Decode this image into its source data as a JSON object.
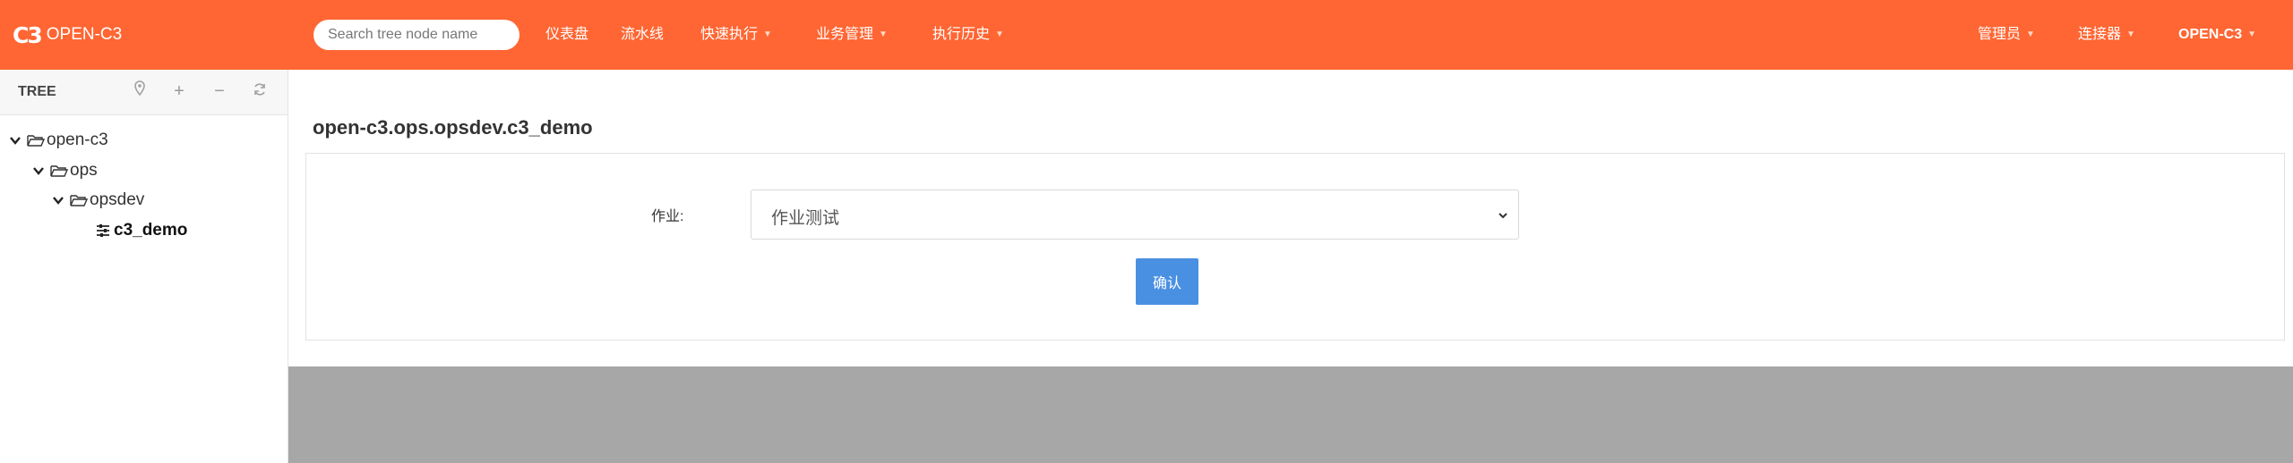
{
  "header": {
    "logo_mark": "C3",
    "logo_text": "OPEN-C3",
    "search_placeholder": "Search tree node name",
    "nav": [
      {
        "label": "仪表盘"
      },
      {
        "label": "流水线"
      },
      {
        "label": "快速执行"
      },
      {
        "label": "业务管理"
      },
      {
        "label": "执行历史"
      }
    ],
    "right_menu": [
      {
        "label": "管理员"
      },
      {
        "label": "连接器"
      },
      {
        "label": "OPEN-C3"
      }
    ],
    "accent_color": "#ff6633"
  },
  "sidebar": {
    "title": "TREE",
    "tools": [
      "location-icon",
      "plus-icon",
      "minus-icon",
      "refresh-icon"
    ],
    "nodes": [
      {
        "label": "open-c3"
      },
      {
        "label": "ops"
      },
      {
        "label": "opsdev"
      },
      {
        "label": "c3_demo"
      }
    ]
  },
  "main": {
    "title": "open-c3.ops.opsdev.c3_demo",
    "form": {
      "job_label": "作业:",
      "job_selected": "作业测试",
      "confirm_label": "确认"
    },
    "confirm_color": "#4a90e2"
  }
}
